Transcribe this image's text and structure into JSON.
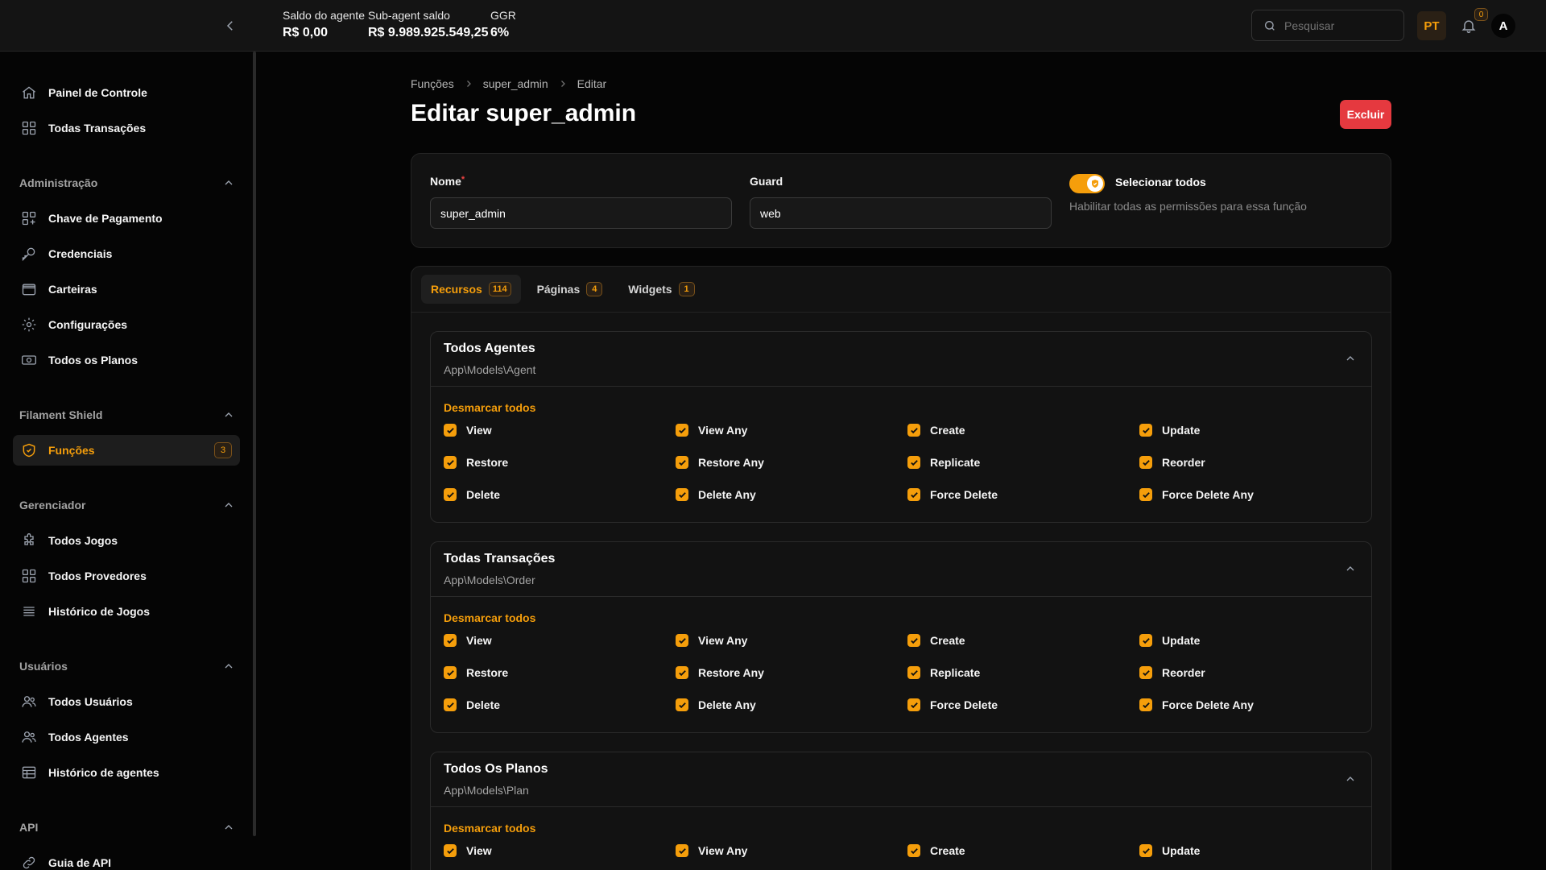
{
  "header": {
    "stats": [
      {
        "label": "Saldo do agente",
        "value": "R$ 0,00"
      },
      {
        "label": "Sub-agent saldo",
        "value": "R$ 9.989.925.549,25"
      },
      {
        "label": "GGR",
        "value": "6%"
      }
    ],
    "search_placeholder": "Pesquisar",
    "language": "PT",
    "notifications_count": "0",
    "avatar_initial": "A"
  },
  "sidebar": {
    "top_items": [
      {
        "label": "Painel de Controle",
        "icon": "home-icon"
      },
      {
        "label": "Todas Transações",
        "icon": "grid-icon"
      }
    ],
    "groups": [
      {
        "title": "Administração",
        "items": [
          {
            "label": "Chave de Pagamento",
            "icon": "grid-plus-icon"
          },
          {
            "label": "Credenciais",
            "icon": "key-icon"
          },
          {
            "label": "Carteiras",
            "icon": "wallet-icon"
          },
          {
            "label": "Configurações",
            "icon": "gear-icon"
          },
          {
            "label": "Todos os Planos",
            "icon": "cash-icon"
          }
        ]
      },
      {
        "title": "Filament Shield",
        "items": [
          {
            "label": "Funções",
            "icon": "shield-icon",
            "badge": "3",
            "active": true
          }
        ]
      },
      {
        "title": "Gerenciador",
        "items": [
          {
            "label": "Todos Jogos",
            "icon": "puzzle-icon"
          },
          {
            "label": "Todos Provedores",
            "icon": "grid-icon"
          },
          {
            "label": "Histórico de Jogos",
            "icon": "list-icon"
          }
        ]
      },
      {
        "title": "Usuários",
        "items": [
          {
            "label": "Todos Usuários",
            "icon": "users-icon"
          },
          {
            "label": "Todos Agentes",
            "icon": "users-icon"
          },
          {
            "label": "Histórico de agentes",
            "icon": "table-icon"
          }
        ]
      },
      {
        "title": "API",
        "items": [
          {
            "label": "Guia de API",
            "icon": "link-icon"
          }
        ]
      }
    ]
  },
  "main": {
    "breadcrumb": [
      "Funções",
      "super_admin",
      "Editar"
    ],
    "title": "Editar super_admin",
    "delete_label": "Excluir",
    "form": {
      "name_label": "Nome",
      "name_required_mark": "*",
      "name_value": "super_admin",
      "guard_label": "Guard",
      "guard_value": "web",
      "select_all_label": "Selecionar todos",
      "select_all_help": "Habilitar todas as permissões para essa função",
      "select_all_on": true
    },
    "tabs": [
      {
        "label": "Recursos",
        "count": "114",
        "active": true
      },
      {
        "label": "Páginas",
        "count": "4"
      },
      {
        "label": "Widgets",
        "count": "1"
      }
    ],
    "deselect_label": "Desmarcar todos",
    "sections": [
      {
        "title": "Todos Agentes",
        "subtitle": "App\\Models\\Agent",
        "permissions": [
          "View",
          "View Any",
          "Create",
          "Update",
          "Restore",
          "Restore Any",
          "Replicate",
          "Reorder",
          "Delete",
          "Delete Any",
          "Force Delete",
          "Force Delete Any"
        ]
      },
      {
        "title": "Todas Transações",
        "subtitle": "App\\Models\\Order",
        "permissions": [
          "View",
          "View Any",
          "Create",
          "Update",
          "Restore",
          "Restore Any",
          "Replicate",
          "Reorder",
          "Delete",
          "Delete Any",
          "Force Delete",
          "Force Delete Any"
        ]
      },
      {
        "title": "Todos Os Planos",
        "subtitle": "App\\Models\\Plan",
        "permissions": [
          "View",
          "View Any",
          "Create",
          "Update"
        ]
      }
    ]
  },
  "colors": {
    "accent": "#f59e0b",
    "danger": "#e5393f",
    "background": "#050505",
    "surface": "#121212"
  }
}
